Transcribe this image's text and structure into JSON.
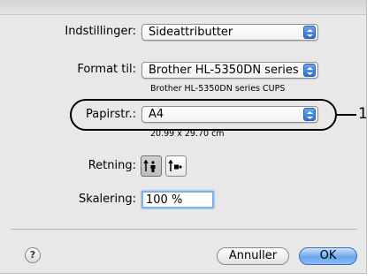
{
  "settings": {
    "label": "Indstillinger:",
    "value": "Sideattributter"
  },
  "format_for": {
    "label": "Format til:",
    "value": "Brother HL-5350DN series",
    "subtitle": "Brother HL-5350DN series CUPS"
  },
  "paper_size": {
    "label": "Papirstr.:",
    "value": "A4",
    "dimensions": "20.99 x 29.70 cm"
  },
  "orientation": {
    "label": "Retning:",
    "options": [
      "portrait-icon",
      "landscape-icon"
    ],
    "selected": "portrait-icon"
  },
  "scale": {
    "label": "Skalering:",
    "value": "100 %"
  },
  "callout": {
    "number": "1"
  },
  "buttons": {
    "help": "?",
    "cancel": "Annuller",
    "ok": "OK"
  },
  "colors": {
    "accent": "#3b7ddd",
    "focus_ring": "#7fb0ec",
    "dialog_bg": "#e8e8e8"
  }
}
